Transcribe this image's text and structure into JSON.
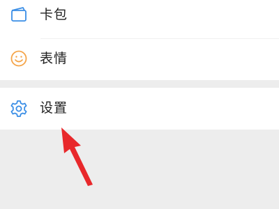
{
  "menu": {
    "items": [
      {
        "label": "卡包",
        "icon": "card-wallet-icon"
      },
      {
        "label": "表情",
        "icon": "smiley-icon"
      },
      {
        "label": "设置",
        "icon": "gear-icon"
      }
    ]
  },
  "colors": {
    "icon_blue": "#3a8ee6",
    "icon_orange": "#f5a54a",
    "annotation_red": "#e8282b",
    "background": "#ededed"
  }
}
